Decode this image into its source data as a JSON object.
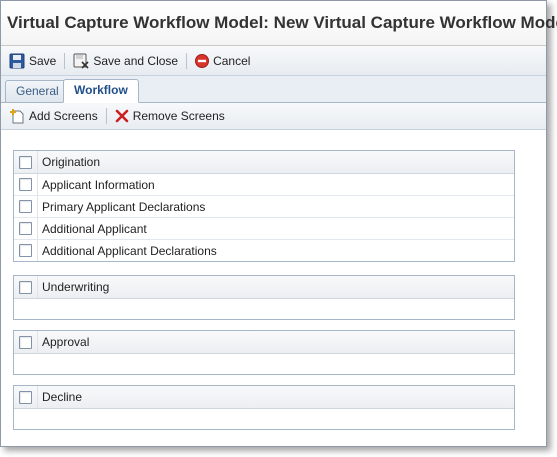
{
  "window": {
    "title": "Virtual Capture Workflow Model: New Virtual Capture Workflow Model"
  },
  "toolbar": {
    "save_label": "Save",
    "save_close_label": "Save and Close",
    "cancel_label": "Cancel"
  },
  "tabs": [
    {
      "label": "General"
    },
    {
      "label": "Workflow"
    }
  ],
  "subtoolbar": {
    "add_label": "Add Screens",
    "remove_label": "Remove Screens"
  },
  "groups": [
    {
      "name": "Origination",
      "screens": [
        "Applicant Information",
        "Primary Applicant Declarations",
        "Additional Applicant",
        "Additional Applicant Declarations"
      ]
    },
    {
      "name": "Underwriting",
      "screens": []
    },
    {
      "name": "Approval",
      "screens": []
    },
    {
      "name": "Decline",
      "screens": []
    }
  ],
  "colors": {
    "accent": "#1f4f8a",
    "border": "#a7b7c8",
    "cancel_icon": "#d9342b",
    "remove_icon": "#cc1f1f"
  }
}
